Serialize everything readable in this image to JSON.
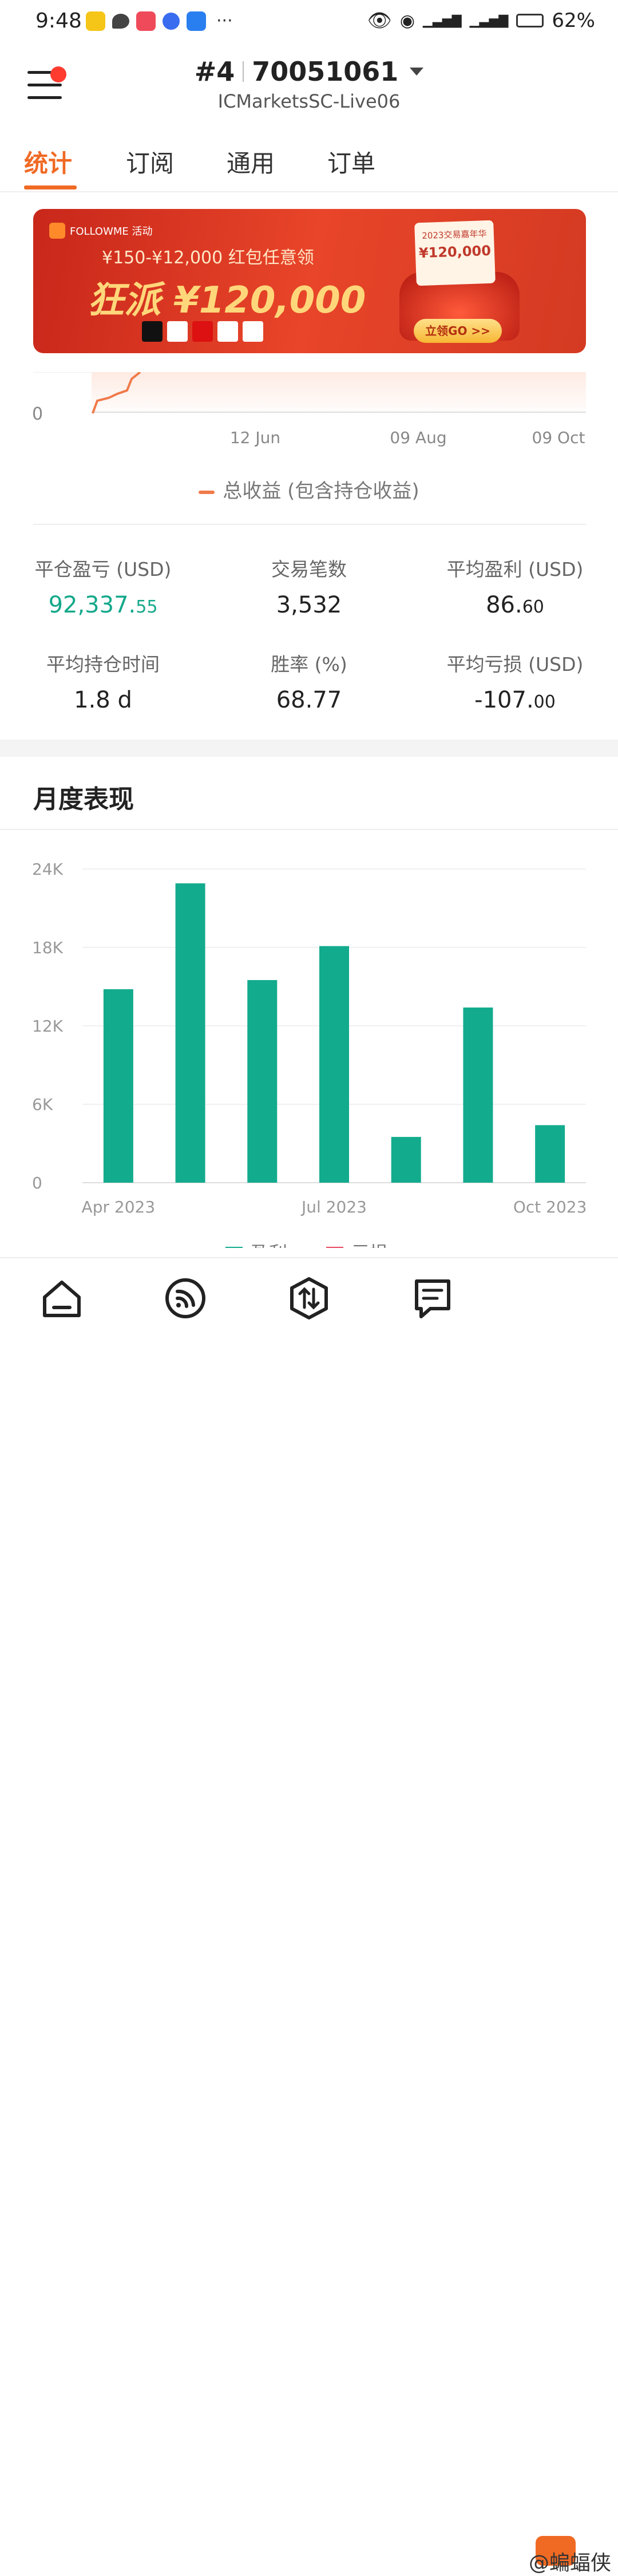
{
  "status_bar": {
    "time": "9:48",
    "battery": "62%",
    "network": "4G"
  },
  "header": {
    "account_prefix": "#4",
    "account_number": "70051061",
    "server": "ICMarketsSC-Live06"
  },
  "tabs": [
    {
      "label": "统计",
      "active": true
    },
    {
      "label": "订阅",
      "active": false
    },
    {
      "label": "通用",
      "active": false
    },
    {
      "label": "订单",
      "active": false
    }
  ],
  "banner": {
    "brand": "FOLLOWME 活动",
    "line1": "¥150-¥12,000 红包任意领",
    "line2": "狂派 ¥120,000",
    "card_title": "2023交易嘉年华",
    "card_amount": "¥120,000",
    "cta": "立领GO >>"
  },
  "equity_chart": {
    "y_label": "0",
    "x_ticks": [
      "12 Jun",
      "09 Aug",
      "09 Oct"
    ],
    "legend": "总收益 (包含持仓收益)",
    "color": "#f07a4a"
  },
  "stats": {
    "closed_pl_label": "平仓盈亏 (USD)",
    "closed_pl_main": "92,337.",
    "closed_pl_dec": "55",
    "trades_label": "交易笔数",
    "trades_value": "3,532",
    "avg_profit_label": "平均盈利 (USD)",
    "avg_profit_main": "86.",
    "avg_profit_dec": "60",
    "avg_hold_label": "平均持仓时间",
    "avg_hold_value": "1.8 d",
    "win_rate_label": "胜率 (%)",
    "win_rate_value": "68.77",
    "avg_loss_label": "平均亏损 (USD)",
    "avg_loss_main": "-107.",
    "avg_loss_dec": "00"
  },
  "monthly": {
    "title": "月度表现",
    "legend_profit": "盈利",
    "legend_loss": "亏损"
  },
  "chart_data": {
    "type": "bar",
    "categories": [
      "Apr 2023",
      "May 2023",
      "Jun 2023",
      "Jul 2023",
      "Aug 2023",
      "Sep 2023",
      "Oct 2023"
    ],
    "x_tick_labels": [
      "Apr 2023",
      "Jul 2023",
      "Oct 2023"
    ],
    "series": [
      {
        "name": "盈利",
        "values": [
          14800,
          22900,
          15500,
          18100,
          3500,
          13400,
          4400
        ],
        "color": "#13ab8d"
      }
    ],
    "y_ticks": [
      "24K",
      "18K",
      "12K",
      "6K",
      "0"
    ],
    "ylim": [
      0,
      24000
    ],
    "grid": true
  },
  "bottom_nav": [
    {
      "icon": "home-icon"
    },
    {
      "icon": "signal-icon"
    },
    {
      "icon": "trade-icon"
    },
    {
      "icon": "orders-icon"
    }
  ],
  "watermark": "@蝙蝠侠"
}
